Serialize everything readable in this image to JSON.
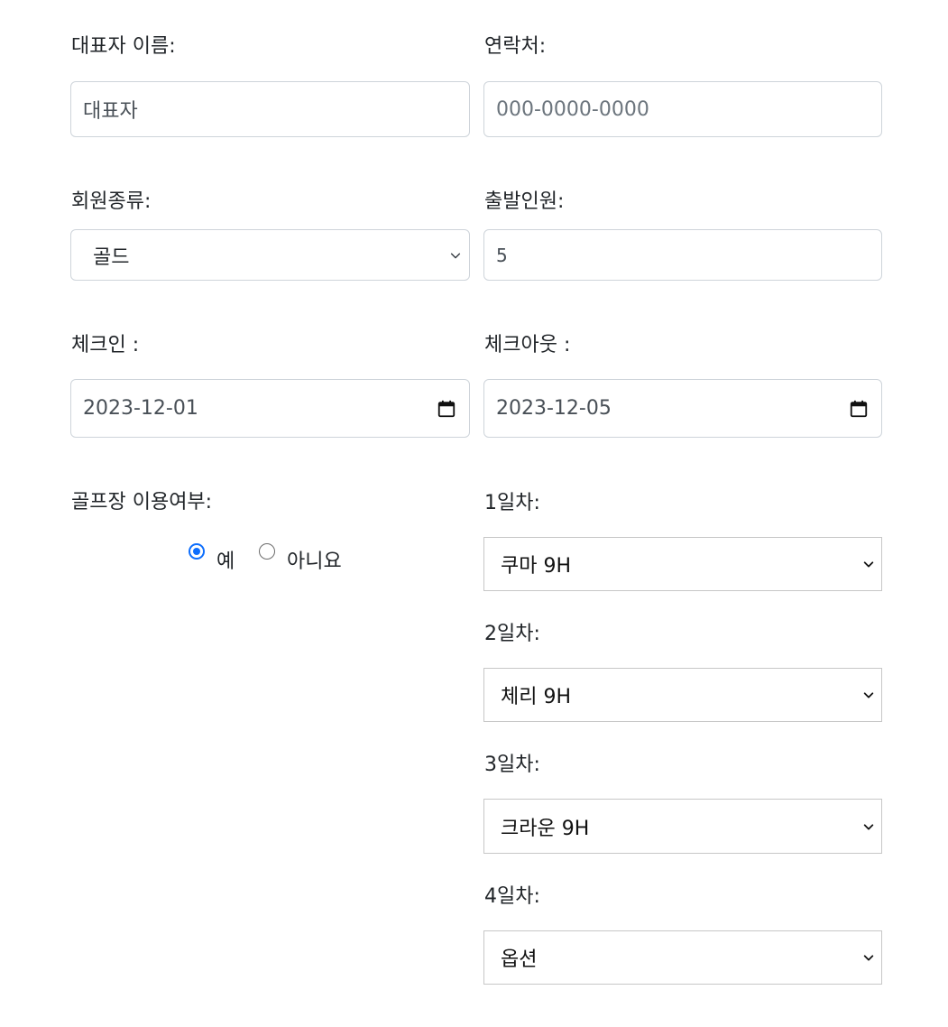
{
  "representative": {
    "label": "대표자 이름:",
    "value": "대표자"
  },
  "contact": {
    "label": "연락처:",
    "placeholder": "000-0000-0000"
  },
  "membership": {
    "label": "회원종류:",
    "selected": "골드"
  },
  "departure_count": {
    "label": "출발인원:",
    "value": "5"
  },
  "checkin": {
    "label": "체크인 :",
    "value": "2023-12-01"
  },
  "checkout": {
    "label": "체크아웃 :",
    "value": "2023-12-05"
  },
  "golf_usage": {
    "label": "골프장 이용여부:",
    "options": [
      {
        "label": "예",
        "checked": true
      },
      {
        "label": "아니요",
        "checked": false
      }
    ]
  },
  "days": [
    {
      "label": "1일차:",
      "selected": "쿠마 9H"
    },
    {
      "label": "2일차:",
      "selected": "체리 9H"
    },
    {
      "label": "3일차:",
      "selected": "크라운 9H"
    },
    {
      "label": "4일차:",
      "selected": "옵션"
    }
  ],
  "colors": {
    "accent": "#0d6efd",
    "border": "#ced4da",
    "text": "#212529"
  }
}
